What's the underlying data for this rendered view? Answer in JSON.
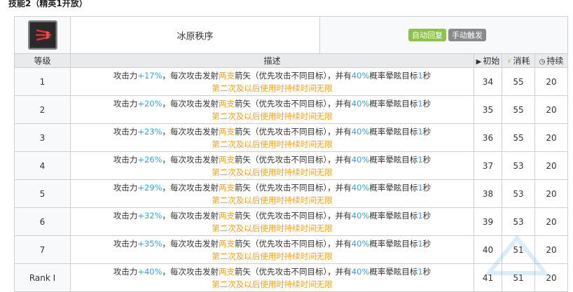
{
  "section_title": "技能2（精英1开放）",
  "skill": {
    "name": "冰原秩序",
    "icon": "skill-icon",
    "tags": [
      {
        "label": "自动回复",
        "color": "#8cc24a"
      },
      {
        "label": "手动触发",
        "color": "#8a8a8a"
      }
    ]
  },
  "columns": {
    "level": "等级",
    "desc": "描述",
    "initial": "初始",
    "cost": "消耗",
    "duration": "持续"
  },
  "desc_parts": {
    "p1": "攻击力",
    "p2": "，每次攻击发射",
    "p3": "两支",
    "p4": "箭矢（优先攻击不同目标），并有",
    "p5": "40%",
    "p6": "概率晕眩目标",
    "p7": "1",
    "p8": "秒",
    "line2": "第二次及以后使用时持续时间无限"
  },
  "rows": [
    {
      "level": "1",
      "atk": "+17%",
      "initial": "34",
      "cost": "55",
      "duration": "20"
    },
    {
      "level": "2",
      "atk": "+20%",
      "initial": "35",
      "cost": "55",
      "duration": "20"
    },
    {
      "level": "3",
      "atk": "+23%",
      "initial": "36",
      "cost": "55",
      "duration": "20"
    },
    {
      "level": "4",
      "atk": "+26%",
      "initial": "37",
      "cost": "53",
      "duration": "20"
    },
    {
      "level": "5",
      "atk": "+29%",
      "initial": "38",
      "cost": "53",
      "duration": "20"
    },
    {
      "level": "6",
      "atk": "+32%",
      "initial": "39",
      "cost": "53",
      "duration": "20"
    },
    {
      "level": "7",
      "atk": "+35%",
      "initial": "40",
      "cost": "51",
      "duration": "20"
    },
    {
      "level": "Rank Ⅰ",
      "atk": "+40%",
      "initial": "41",
      "cost": "51",
      "duration": "20"
    }
  ],
  "colors": {
    "blue": "#3aa0d8",
    "orange": "#f0a01e",
    "tag_green": "#8cc24a",
    "tag_gray": "#8a8a8a"
  }
}
